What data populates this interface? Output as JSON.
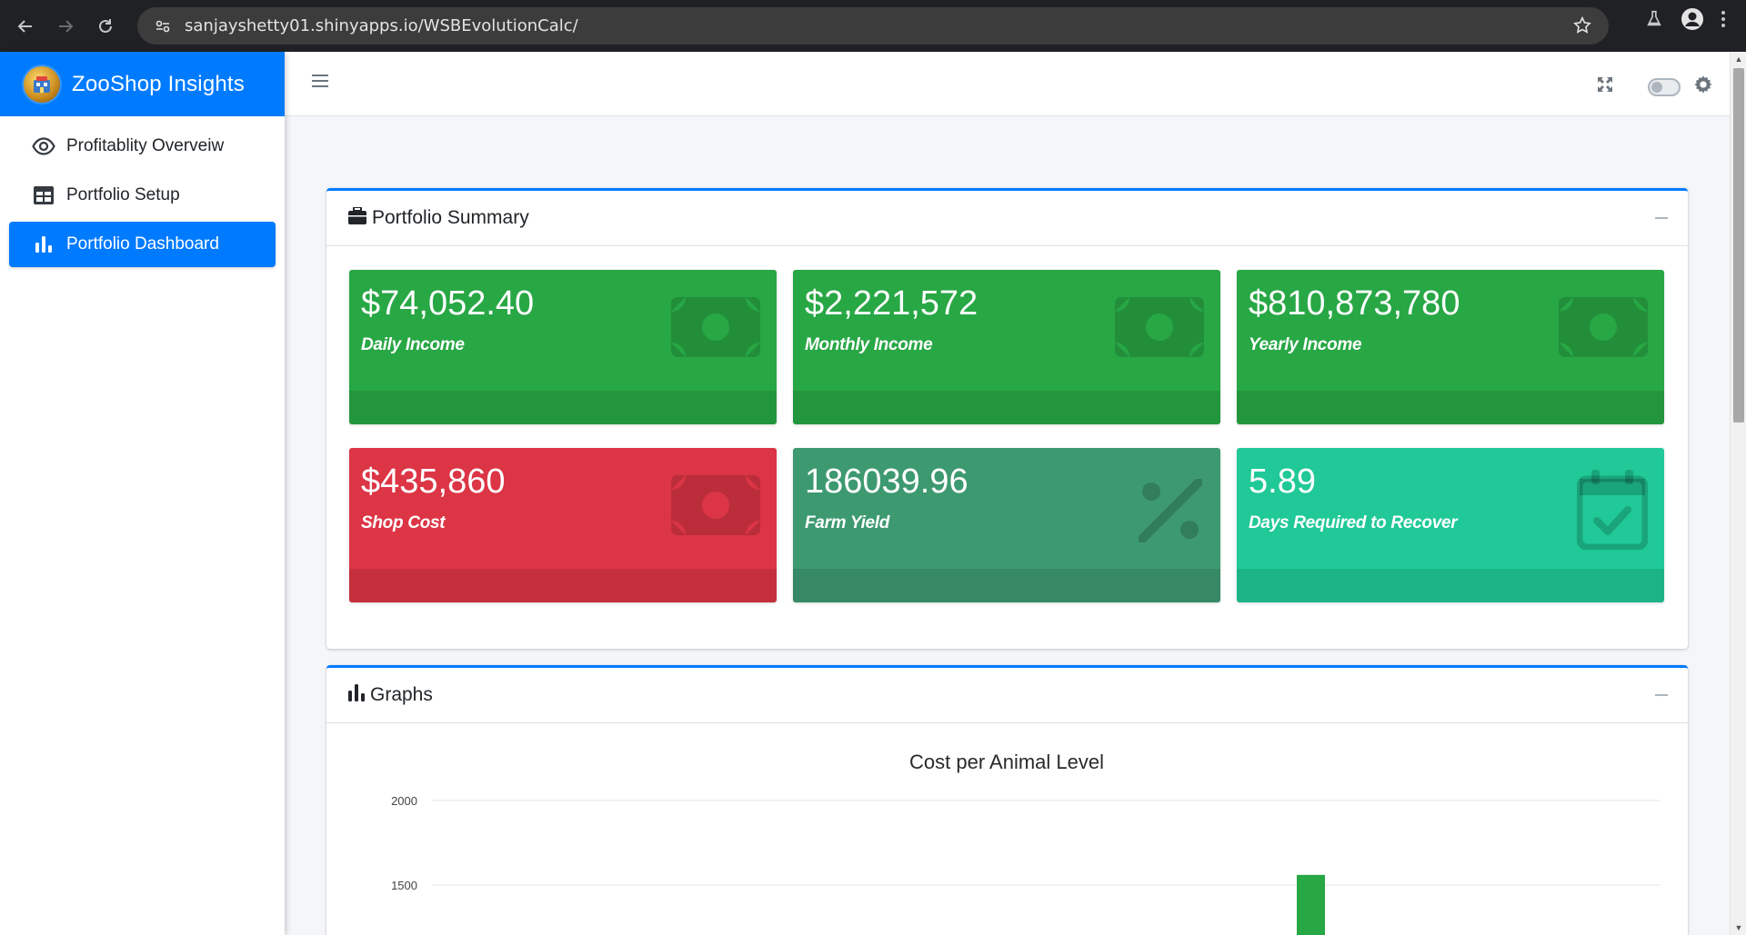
{
  "browser": {
    "url": "sanjayshetty01.shinyapps.io/WSBEvolutionCalc/"
  },
  "app": {
    "title": "ZooShop Insights"
  },
  "sidebar": {
    "items": [
      {
        "label": "Profitablity Overveiw",
        "icon": "eye-icon",
        "active": false
      },
      {
        "label": "Portfolio Setup",
        "icon": "table-icon",
        "active": false
      },
      {
        "label": "Portfolio Dashboard",
        "icon": "bar-chart-icon",
        "active": true
      }
    ]
  },
  "summary": {
    "title": "Portfolio Summary",
    "boxes": [
      {
        "value": "$74,052.40",
        "label": "Daily Income",
        "color": "#28a745",
        "icon": "money-bill-icon"
      },
      {
        "value": "$2,221,572",
        "label": "Monthly Income",
        "color": "#28a745",
        "icon": "money-bill-icon"
      },
      {
        "value": "$810,873,780",
        "label": "Yearly Income",
        "color": "#28a745",
        "icon": "money-bill-icon"
      },
      {
        "value": "$435,860",
        "label": "Shop Cost",
        "color": "#dc3545",
        "icon": "money-bill-icon"
      },
      {
        "value": "186039.96",
        "label": "Farm Yield",
        "color": "#3d9970",
        "icon": "percent-icon"
      },
      {
        "value": "5.89",
        "label": "Days Required to Recover",
        "color": "#20c997",
        "icon": "calendar-check-icon"
      }
    ]
  },
  "graphs": {
    "title": "Graphs"
  },
  "chart_data": {
    "type": "bar",
    "title": "Cost per Animal Level",
    "ytick_labels": [
      "2000",
      "1500"
    ],
    "ylim": [
      0,
      2000
    ],
    "visible_bars": [
      {
        "value": 1560,
        "color": "#28a745"
      }
    ],
    "grid": true
  }
}
